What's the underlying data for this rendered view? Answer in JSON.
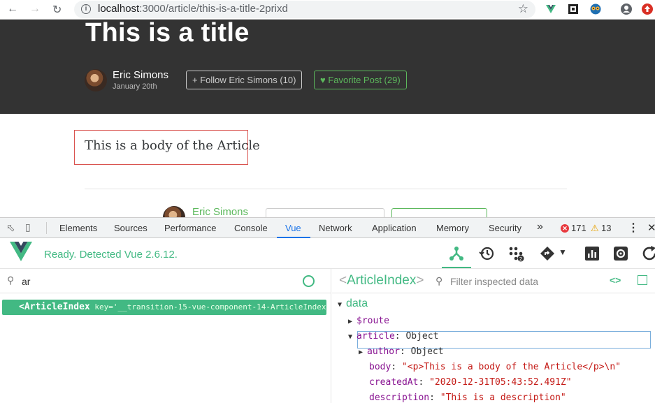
{
  "browser": {
    "url_host": "localhost",
    "url_rest": ":3000/article/this-is-a-title-2prixd"
  },
  "article": {
    "title": "This is a title",
    "author": "Eric Simons",
    "date": "January 20th",
    "follow_label": "Follow Eric Simons (10)",
    "favorite_label": "Favorite Post (29)",
    "body": "This is a body of the Article",
    "footer_author": "Eric Simons"
  },
  "devtools": {
    "tabs": [
      "Elements",
      "Sources",
      "Performance",
      "Console",
      "Vue",
      "Network",
      "Application",
      "Memory",
      "Security"
    ],
    "active_tab": "Vue",
    "more": "»",
    "error_count": "171",
    "warning_count": "13",
    "vue_status": "Ready. Detected Vue 2.6.12.",
    "search_query": "ar",
    "component_tag": "<ArticleIndex",
    "component_key": " key='__transition-15-vue-component-14-ArticleIndex'",
    "inspected_name": "ArticleIndex",
    "filter_placeholder": "Filter inspected data",
    "tree": {
      "section": "data",
      "route": "$route",
      "article_key": "article",
      "article_val": "Object",
      "author_key": "author",
      "author_val": "Object",
      "body_key": "body",
      "body_val": "\"<p>This is a body of the Article</p>\\n\"",
      "created_key": "createdAt",
      "created_val": "\"2020-12-31T05:43:52.491Z\"",
      "desc_key": "description",
      "desc_val": "\"This is a description\""
    }
  },
  "colors": {
    "vue_green": "#42b983",
    "banner_bg": "#333333",
    "error_red": "#e8383d",
    "highlight_border": "#d9534f"
  }
}
